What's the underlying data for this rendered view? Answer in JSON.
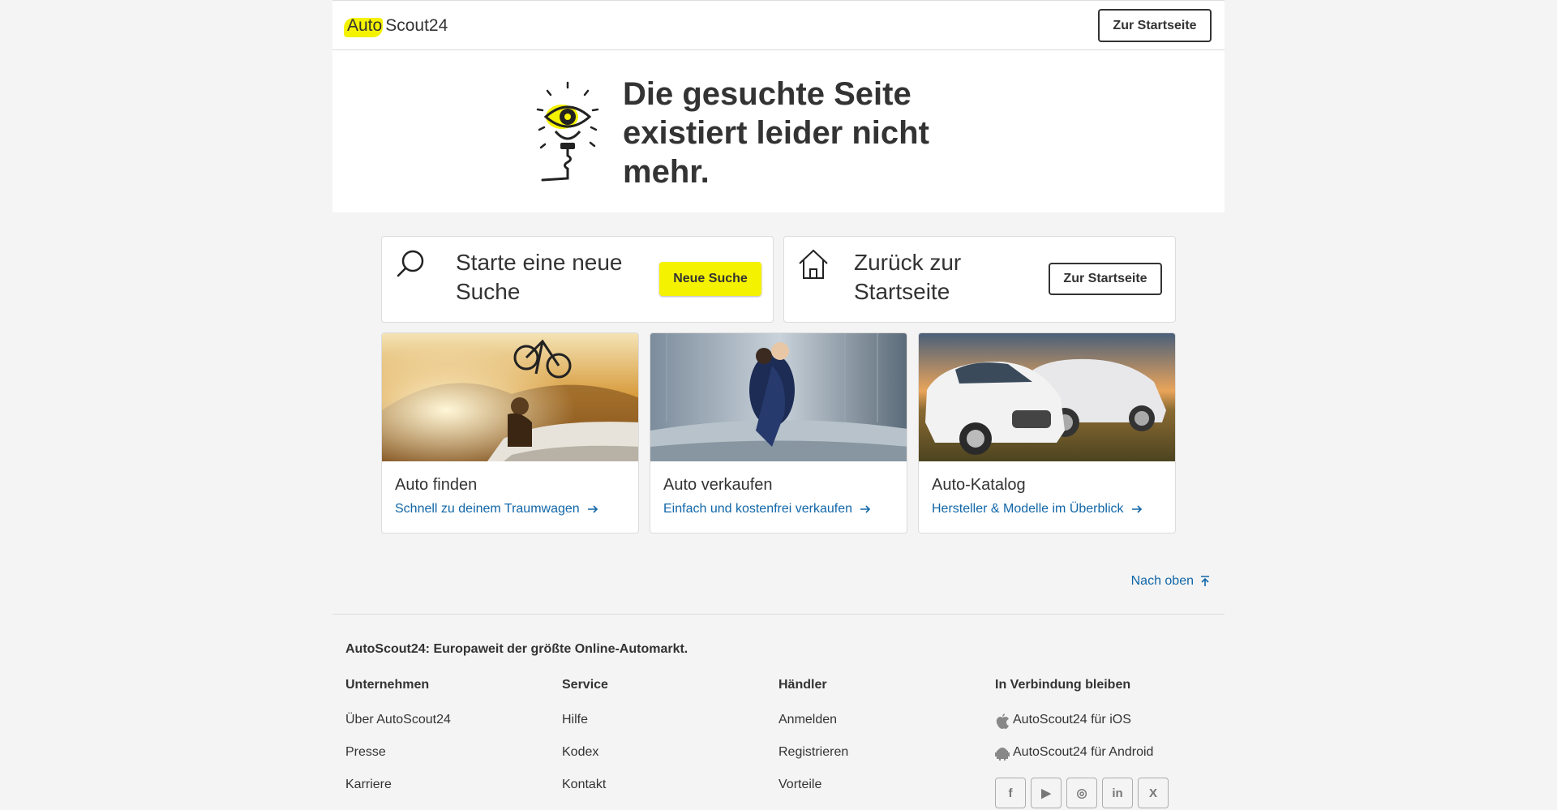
{
  "header": {
    "logo_auto": "Auto",
    "logo_scout": "Scout24",
    "start_button": "Zur Startseite"
  },
  "hero": {
    "title": "Die gesuchte Seite existiert leider nicht mehr."
  },
  "actions": {
    "search": {
      "text": "Starte eine neue Suche",
      "button": "Neue Suche",
      "icon": "search-icon"
    },
    "home": {
      "text": "Zurück zur Startseite",
      "button": "Zur Startseite",
      "icon": "home-icon"
    }
  },
  "tiles": [
    {
      "title": "Auto finden",
      "link": "Schnell zu deinem Traumwagen"
    },
    {
      "title": "Auto verkaufen",
      "link": "Einfach und kostenfrei verkaufen"
    },
    {
      "title": "Auto-Katalog",
      "link": "Hersteller & Modelle im Überblick"
    }
  ],
  "nach_oben": "Nach oben",
  "footer": {
    "tagline": "AutoScout24: Europaweit der größte Online-Automarkt.",
    "columns": [
      {
        "head": "Unternehmen",
        "items": [
          "Über AutoScout24",
          "Presse",
          "Karriere"
        ]
      },
      {
        "head": "Service",
        "items": [
          "Hilfe",
          "Kodex",
          "Kontakt"
        ]
      },
      {
        "head": "Händler",
        "items": [
          "Anmelden",
          "Registrieren",
          "Vorteile"
        ]
      }
    ],
    "connect": {
      "head": "In Verbindung bleiben",
      "ios": "AutoScout24 für iOS",
      "android": "AutoScout24 für Android",
      "socials": [
        "f",
        "▶",
        "◎",
        "in",
        "X"
      ]
    }
  },
  "colors": {
    "brand_yellow": "#f5f200",
    "link_blue": "#1166a8",
    "text": "#333333",
    "bg": "#f4f4f4"
  }
}
